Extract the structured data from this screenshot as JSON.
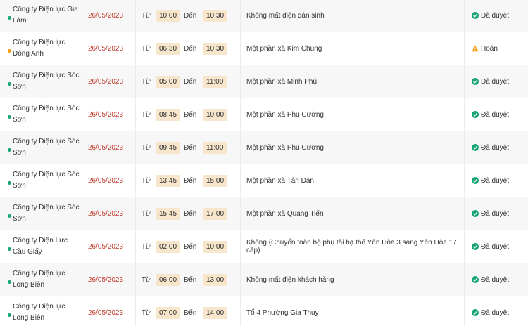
{
  "labels": {
    "from": "Từ",
    "to": "Đến"
  },
  "colors": {
    "approved": "#1aa579",
    "postponed": "#f39c12",
    "date": "#c0392b",
    "time_pill": "#f7e6cc"
  },
  "rows": [
    {
      "unit": "Công ty Điện lực Gia Lâm",
      "date": "26/05/2023",
      "start": "10:00",
      "end": "10:30",
      "area": "Không mất điện dân sinh",
      "status": "Đã duyệt",
      "state": "approved"
    },
    {
      "unit": "Công ty Điện lực Đông Anh",
      "date": "26/05/2023",
      "start": "06:30",
      "end": "10:30",
      "area": "Một phần xã Kim Chung",
      "status": "Hoãn",
      "state": "postponed"
    },
    {
      "unit": "Công ty Điện lực Sóc Sơn",
      "date": "26/05/2023",
      "start": "05:00",
      "end": "11:00",
      "area": "Một phần xã Minh Phú",
      "status": "Đã duyệt",
      "state": "approved"
    },
    {
      "unit": "Công ty Điện lực Sóc Sơn",
      "date": "26/05/2023",
      "start": "08:45",
      "end": "10:00",
      "area": "Một phần xã Phú Cường",
      "status": "Đã duyệt",
      "state": "approved"
    },
    {
      "unit": "Công ty Điện lực Sóc Sơn",
      "date": "26/05/2023",
      "start": "09:45",
      "end": "11:00",
      "area": "Một phần xã Phú Cường",
      "status": "Đã duyệt",
      "state": "approved"
    },
    {
      "unit": "Công ty Điện lực Sóc Sơn",
      "date": "26/05/2023",
      "start": "13:45",
      "end": "15:00",
      "area": "Một phần xã Tân Dân",
      "status": "Đã duyệt",
      "state": "approved"
    },
    {
      "unit": "Công ty Điện lực Sóc Sơn",
      "date": "26/05/2023",
      "start": "15:45",
      "end": "17:00",
      "area": "Một phần xã Quang Tiến",
      "status": "Đã duyệt",
      "state": "approved"
    },
    {
      "unit": "Công ty Điện Lực Cầu Giấy",
      "date": "26/05/2023",
      "start": "02:00",
      "end": "10:00",
      "area": "Không (Chuyển toàn bộ phụ tải hạ thế Yên Hòa 3 sang Yên Hòa 17 cấp)",
      "status": "Đã duyệt",
      "state": "approved"
    },
    {
      "unit": "Công ty Điện lực Long Biên",
      "date": "26/05/2023",
      "start": "06:00",
      "end": "13:00",
      "area": "Không mất điện khách hàng",
      "status": "Đã duyệt",
      "state": "approved"
    },
    {
      "unit": "Công ty Điện lực Long Biên",
      "date": "26/05/2023",
      "start": "07:00",
      "end": "14:00",
      "area": "Tổ 4 Phường Gia Thụy",
      "status": "Đã duyệt",
      "state": "approved"
    }
  ]
}
